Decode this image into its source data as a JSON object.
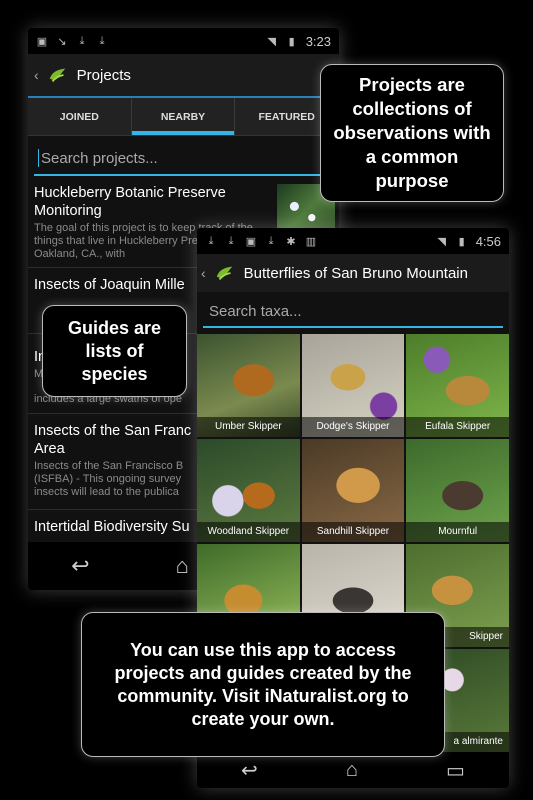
{
  "phone1": {
    "status_time": "3:23",
    "title": "Projects",
    "tabs": [
      "JOINED",
      "NEARBY",
      "FEATURED"
    ],
    "active_tab": 1,
    "search_placeholder": "Search projects...",
    "projects": [
      {
        "title": "Huckleberry Botanic Preserve Monitoring",
        "desc": "The goal of this project is to keep track of the things that live in Huckleberry Preserve in Oakland, CA., with"
      },
      {
        "title": "Insects of Joaquin Mille",
        "desc": ""
      },
      {
        "title": "In",
        "desc": "M"
      },
      {
        "title": "",
        "desc": "includes a large swaths of ope"
      },
      {
        "title": "Insects of the San Franc Area",
        "desc": "Insects of the San Francisco B (ISFBA) - This ongoing survey insects will lead to the publica"
      },
      {
        "title": "Intertidal Biodiversity Su",
        "desc": ""
      }
    ]
  },
  "phone2": {
    "status_time": "4:56",
    "title": "Butterflies of San Bruno Mountain",
    "search_placeholder": "Search taxa...",
    "taxa": [
      "Umber Skipper",
      "Dodge's Skipper",
      "Eufala Skipper",
      "Woodland Skipper",
      "Sandhill Skipper",
      "Mournful",
      "",
      "",
      "Skipper",
      "",
      "",
      "a almirante"
    ]
  },
  "callouts": {
    "projects": "Projects are collections of observations with a common purpose",
    "guides": "Guides are lists of species",
    "bottom": "You can use this app to access projects and guides created by the community. Visit iNaturalist.org to create your own."
  },
  "icons": {
    "back": "chevron-left-icon",
    "logo": "inaturalist-bird-logo",
    "nav_back": "back-arrow-icon",
    "nav_home": "home-icon",
    "nav_recent": "recent-apps-icon"
  },
  "colors": {
    "accent": "#35b5e5",
    "logo_green": "#7dbb2e"
  }
}
